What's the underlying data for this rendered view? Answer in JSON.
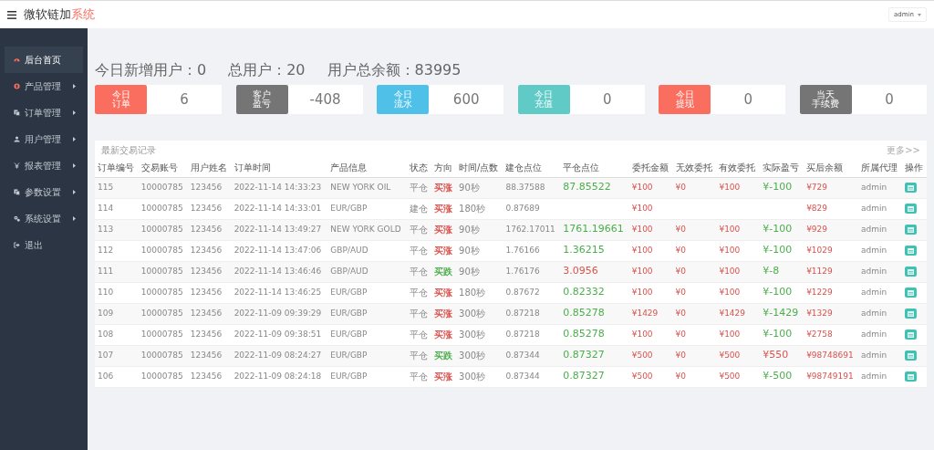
{
  "header": {
    "brand": "微软链加",
    "brand_accent": "系统",
    "user_menu": "admin"
  },
  "sidebar": {
    "items": [
      {
        "label": "后台首页",
        "selected": true,
        "has_submenu": false
      },
      {
        "label": "产品管理",
        "selected": false,
        "has_submenu": true
      },
      {
        "label": "订单管理",
        "selected": false,
        "has_submenu": true
      },
      {
        "label": "用户管理",
        "selected": false,
        "has_submenu": true
      },
      {
        "label": "报表管理",
        "selected": false,
        "has_submenu": true
      },
      {
        "label": "参数设置",
        "selected": false,
        "has_submenu": true
      },
      {
        "label": "系统设置",
        "selected": false,
        "has_submenu": true
      },
      {
        "label": "退出",
        "selected": false,
        "has_submenu": false
      }
    ]
  },
  "summary": [
    {
      "label": "今日新增用户：",
      "value": "0"
    },
    {
      "label": "总用户：",
      "value": "20"
    },
    {
      "label": "用户总余额：",
      "value": "83995"
    }
  ],
  "stats": [
    {
      "label": "今日订单",
      "value": "6",
      "color": "#fa6e5f"
    },
    {
      "label": "客户盈亏",
      "value": "-408",
      "color": "#757575"
    },
    {
      "label": "今日流水",
      "value": "600",
      "color": "#4fc1e9"
    },
    {
      "label": "今日充值",
      "value": "0",
      "color": "#5fcac6"
    },
    {
      "label": "今日提现",
      "value": "0",
      "color": "#fa6e5f"
    },
    {
      "label": "当天手续费",
      "value": "0",
      "color": "#757575"
    }
  ],
  "table": {
    "title": "最新交易记录",
    "more_link": "更多>>",
    "columns": [
      "订单编号",
      "交易账号",
      "用户姓名",
      "订单时间",
      "产品信息",
      "状态",
      "方向",
      "时间/点数",
      "建仓点位",
      "平仓点位",
      "委托金额",
      "无效委托",
      "有效委托",
      "实际盈亏",
      "买后余额",
      "所属代理",
      "操作"
    ],
    "rows": [
      {
        "id": "115",
        "account": "10000785",
        "name": "123456",
        "time": "2022-11-14 14:33:23",
        "product": "NEW YORK OIL",
        "status": "平仓",
        "direction": {
          "text": "买涨",
          "color": "#d9534f"
        },
        "duration": "90秒",
        "open": "88.37588",
        "close": {
          "text": "87.85522",
          "color": "#4cae4c"
        },
        "amount": "¥100",
        "invalid": "¥0",
        "valid": "¥100",
        "pnl": {
          "text": "¥-100",
          "color": "#4cae4c"
        },
        "balance": "¥729",
        "agent": "admin"
      },
      {
        "id": "114",
        "account": "10000785",
        "name": "123456",
        "time": "2022-11-14 14:33:01",
        "product": "EUR/GBP",
        "status": "建仓",
        "direction": {
          "text": "买涨",
          "color": "#d9534f"
        },
        "duration": "180秒",
        "open": "0.87689",
        "amount": "¥100",
        "balance": "¥829",
        "agent": "admin"
      },
      {
        "id": "113",
        "account": "10000785",
        "name": "123456",
        "time": "2022-11-14 13:49:27",
        "product": "NEW YORK GOLD",
        "status": "平仓",
        "direction": {
          "text": "买涨",
          "color": "#d9534f"
        },
        "duration": "90秒",
        "open": "1762.17011",
        "close": {
          "text": "1761.19661",
          "color": "#4cae4c"
        },
        "amount": "¥100",
        "invalid": "¥0",
        "valid": "¥100",
        "pnl": {
          "text": "¥-100",
          "color": "#4cae4c"
        },
        "balance": "¥929",
        "agent": "admin"
      },
      {
        "id": "112",
        "account": "10000785",
        "name": "123456",
        "time": "2022-11-14 13:47:06",
        "product": "GBP/AUD",
        "status": "平仓",
        "direction": {
          "text": "买涨",
          "color": "#d9534f"
        },
        "duration": "90秒",
        "open": "1.76166",
        "close": {
          "text": "1.36215",
          "color": "#4cae4c"
        },
        "amount": "¥100",
        "invalid": "¥0",
        "valid": "¥100",
        "pnl": {
          "text": "¥-100",
          "color": "#4cae4c"
        },
        "balance": "¥1029",
        "agent": "admin"
      },
      {
        "id": "111",
        "account": "10000785",
        "name": "123456",
        "time": "2022-11-14 13:46:46",
        "product": "GBP/AUD",
        "status": "平仓",
        "direction": {
          "text": "买跌",
          "color": "#4cae4c"
        },
        "duration": "90秒",
        "open": "1.76176",
        "close": {
          "text": "3.0956",
          "color": "#d9534f"
        },
        "amount": "¥100",
        "invalid": "¥0",
        "valid": "¥100",
        "pnl": {
          "text": "¥-8",
          "color": "#4cae4c"
        },
        "balance": "¥1129",
        "agent": "admin"
      },
      {
        "id": "110",
        "account": "10000785",
        "name": "123456",
        "time": "2022-11-14 13:46:25",
        "product": "EUR/GBP",
        "status": "平仓",
        "direction": {
          "text": "买涨",
          "color": "#d9534f"
        },
        "duration": "180秒",
        "open": "0.87672",
        "close": {
          "text": "0.82332",
          "color": "#4cae4c"
        },
        "amount": "¥100",
        "invalid": "¥0",
        "valid": "¥100",
        "pnl": {
          "text": "¥-100",
          "color": "#4cae4c"
        },
        "balance": "¥1229",
        "agent": "admin"
      },
      {
        "id": "109",
        "account": "10000785",
        "name": "123456",
        "time": "2022-11-09 09:39:29",
        "product": "EUR/GBP",
        "status": "平仓",
        "direction": {
          "text": "买涨",
          "color": "#d9534f"
        },
        "duration": "300秒",
        "open": "0.87218",
        "close": {
          "text": "0.85278",
          "color": "#4cae4c"
        },
        "amount": "¥1429",
        "invalid": "¥0",
        "valid": "¥1429",
        "pnl": {
          "text": "¥-1429",
          "color": "#4cae4c"
        },
        "balance": "¥1329",
        "agent": "admin"
      },
      {
        "id": "108",
        "account": "10000785",
        "name": "123456",
        "time": "2022-11-09 09:38:51",
        "product": "EUR/GBP",
        "status": "平仓",
        "direction": {
          "text": "买涨",
          "color": "#d9534f"
        },
        "duration": "300秒",
        "open": "0.87218",
        "close": {
          "text": "0.85278",
          "color": "#4cae4c"
        },
        "amount": "¥100",
        "invalid": "¥0",
        "valid": "¥100",
        "pnl": {
          "text": "¥-100",
          "color": "#4cae4c"
        },
        "balance": "¥2758",
        "agent": "admin"
      },
      {
        "id": "107",
        "account": "10000785",
        "name": "123456",
        "time": "2022-11-09 08:24:27",
        "product": "EUR/GBP",
        "status": "平仓",
        "direction": {
          "text": "买跌",
          "color": "#4cae4c"
        },
        "duration": "300秒",
        "open": "0.87344",
        "close": {
          "text": "0.87327",
          "color": "#4cae4c"
        },
        "amount": "¥500",
        "invalid": "¥0",
        "valid": "¥500",
        "pnl": {
          "text": "¥550",
          "color": "#d9534f"
        },
        "balance": "¥98748691",
        "agent": "admin"
      },
      {
        "id": "106",
        "account": "10000785",
        "name": "123456",
        "time": "2022-11-09 08:24:18",
        "product": "EUR/GBP",
        "status": "平仓",
        "direction": {
          "text": "买涨",
          "color": "#d9534f"
        },
        "duration": "300秒",
        "open": "0.87344",
        "close": {
          "text": "0.87327",
          "color": "#4cae4c"
        },
        "amount": "¥500",
        "invalid": "¥0",
        "valid": "¥500",
        "pnl": {
          "text": "¥-500",
          "color": "#4cae4c"
        },
        "balance": "¥98749191",
        "agent": "admin"
      }
    ]
  }
}
